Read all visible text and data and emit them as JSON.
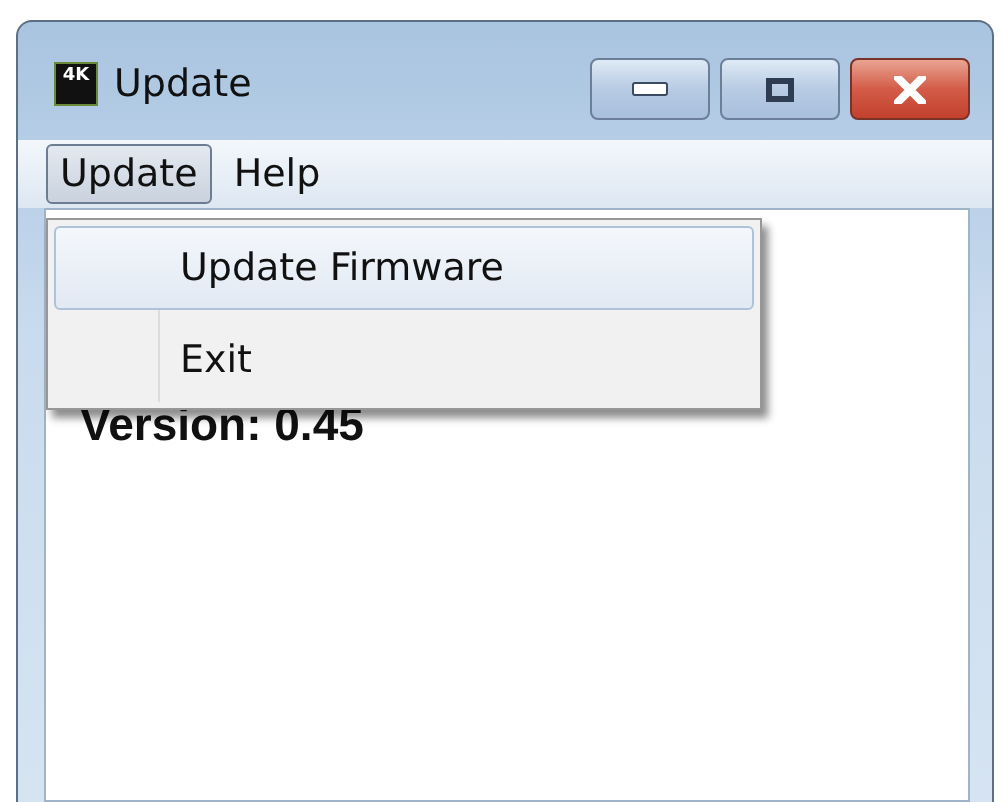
{
  "window": {
    "icon_text": "4K",
    "title": "Update"
  },
  "menu_bar": [
    {
      "label": "Update",
      "selected": true
    },
    {
      "label": "Help",
      "selected": false
    }
  ],
  "dropdown": [
    {
      "label": "Update Firmware",
      "selected": true
    },
    {
      "label": "Exit",
      "selected": false
    }
  ],
  "content": {
    "version": "Version: 0.45"
  }
}
